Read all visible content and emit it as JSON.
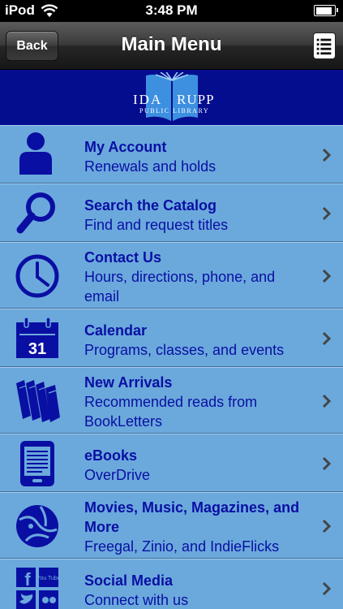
{
  "status_bar": {
    "carrier": "iPod",
    "time": "3:48 PM"
  },
  "nav_bar": {
    "back_label": "Back",
    "title": "Main Menu"
  },
  "banner": {
    "logo_line1": "IDA",
    "logo_line2": "RUPP",
    "logo_line3": "PUBLIC LIBRARY"
  },
  "colors": {
    "accent_text": "#0a0fa3",
    "list_background": "#6ba9dc",
    "banner_background": "#050d8f"
  },
  "menu": {
    "items": [
      {
        "title": "My Account",
        "subtitle": "Renewals and holds",
        "icon": "person-icon"
      },
      {
        "title": "Search the Catalog",
        "subtitle": "Find and request titles",
        "icon": "magnifier-icon"
      },
      {
        "title": "Contact Us",
        "subtitle": "Hours, directions, phone, and email",
        "icon": "clock-icon"
      },
      {
        "title": "Calendar",
        "subtitle": "Programs, classes, and events",
        "icon": "calendar-icon",
        "icon_text": "31"
      },
      {
        "title": "New Arrivals",
        "subtitle": "Recommended reads from BookLetters",
        "icon": "books-icon"
      },
      {
        "title": "eBooks",
        "subtitle": "OverDrive",
        "icon": "ereader-icon"
      },
      {
        "title": "Movies, Music, Magazines, and More",
        "subtitle": "Freegal, Zinio, and IndieFlicks",
        "icon": "media-globe-icon"
      },
      {
        "title": "Social Media",
        "subtitle": "Connect with us",
        "icon": "social-grid-icon",
        "icon_text_1": "f",
        "icon_text_2": "You Tube"
      }
    ]
  }
}
